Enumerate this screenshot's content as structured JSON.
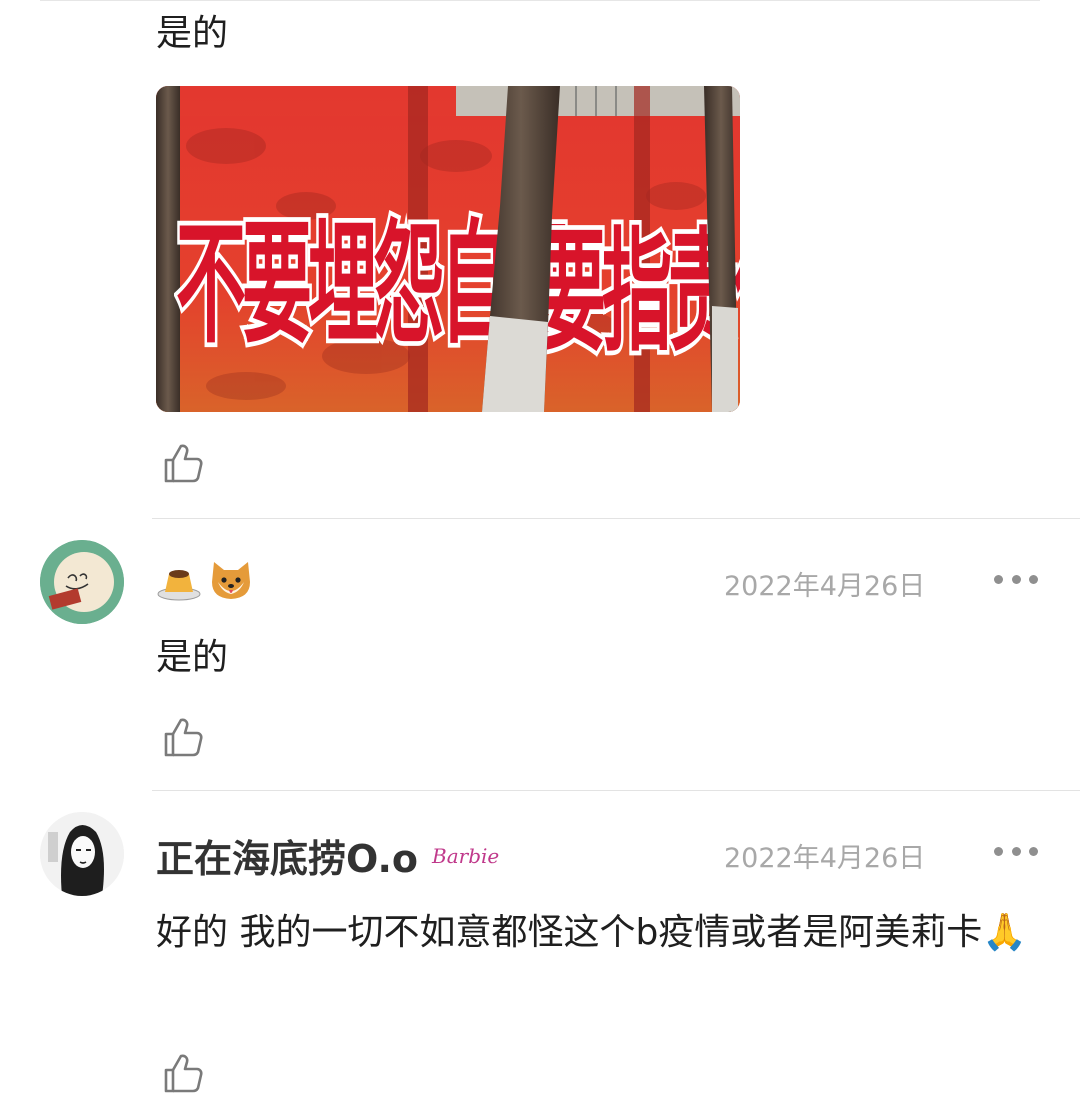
{
  "comments": [
    {
      "text": "是的",
      "image": {
        "banner_left": "不要埋怨自己",
        "banner_right": "要指责他人",
        "colors": {
          "banner_red": "#e8322f",
          "text_red": "#d8142a",
          "trunk": "#4b3c33"
        }
      }
    },
    {
      "username_emoji": [
        "custard-pudding-emoji",
        "shiba-dog-emoji"
      ],
      "date": "2022年4月26日",
      "text": "是的"
    },
    {
      "username": "正在海底捞O.o",
      "badge": "Barbie",
      "date": "2022年4月26日",
      "text": "好的 我的一切不如意都怪这个b疫情或者是阿美莉卡🙏"
    }
  ],
  "colors": {
    "text": "#1f1f1f",
    "username": "#333333",
    "date": "#a8a8a8",
    "divider": "#e3e3e3",
    "icon": "#7a7a7a",
    "avatar1_bg": "#6aaf8f"
  }
}
